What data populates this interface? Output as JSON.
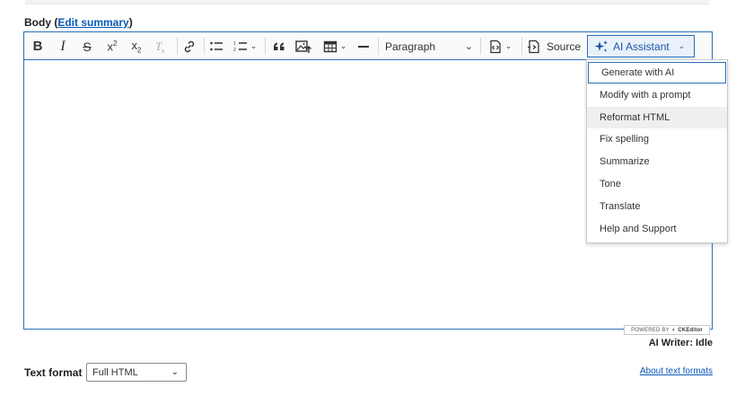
{
  "field": {
    "label": "Body (",
    "edit_summary_link": "Edit summary",
    "label_close": ")"
  },
  "toolbar": {
    "bold": "B",
    "italic": "I",
    "strikethrough": "S",
    "superscript_base": "x",
    "superscript_exp": "2",
    "subscript_base": "x",
    "subscript_sub": "2",
    "paragraph": "Paragraph",
    "source": "Source",
    "ai_assistant": "AI Assistant"
  },
  "ai_menu": {
    "items": [
      "Generate with AI",
      "Modify with a prompt",
      "Reformat HTML",
      "Fix spelling",
      "Summarize",
      "Tone",
      "Translate",
      "Help and Support"
    ]
  },
  "footer": {
    "powered_by": "POWERED BY",
    "ckeditor": "CKEditor",
    "ai_writer_status": "AI Writer: Idle",
    "text_format_label": "Text format",
    "text_format_value": "Full HTML",
    "about_text_formats": "About text formats"
  },
  "colors": {
    "accent": "#2a6fb8",
    "link": "#0a58b8"
  }
}
